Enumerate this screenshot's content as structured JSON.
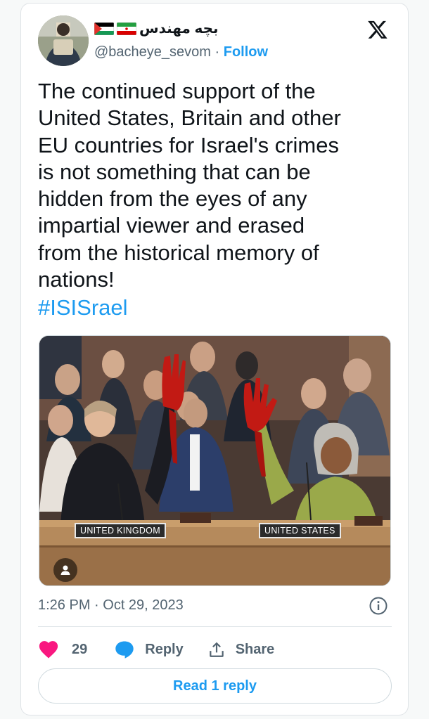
{
  "author": {
    "display_name": "بچه مهندس",
    "handle": "@bacheye_sevom",
    "follow_label": "Follow",
    "separator": "·"
  },
  "tweet": {
    "text": "The continued support of the\nUnited States, Britain and other\nEU countries for Israel's crimes\nis not something that can be\nhidden from the eyes of any\nimpartial viewer and erased\nfrom the historical memory of\nnations!",
    "hashtag": "#ISISrael"
  },
  "media": {
    "nameplates": [
      "UNITED KINGDOM",
      "UNITED STATES"
    ]
  },
  "meta": {
    "timestamp": "1:26 PM · Oct 29, 2023"
  },
  "actions": {
    "like_count": "29",
    "reply_label": "Reply",
    "share_label": "Share",
    "read_replies_label": "Read 1 reply"
  },
  "colors": {
    "accent": "#1d9bf0",
    "like": "#f91880",
    "text_secondary": "#536471"
  },
  "icons": [
    "x-logo-icon",
    "info-icon",
    "heart-icon",
    "reply-icon",
    "share-icon",
    "person-icon"
  ]
}
